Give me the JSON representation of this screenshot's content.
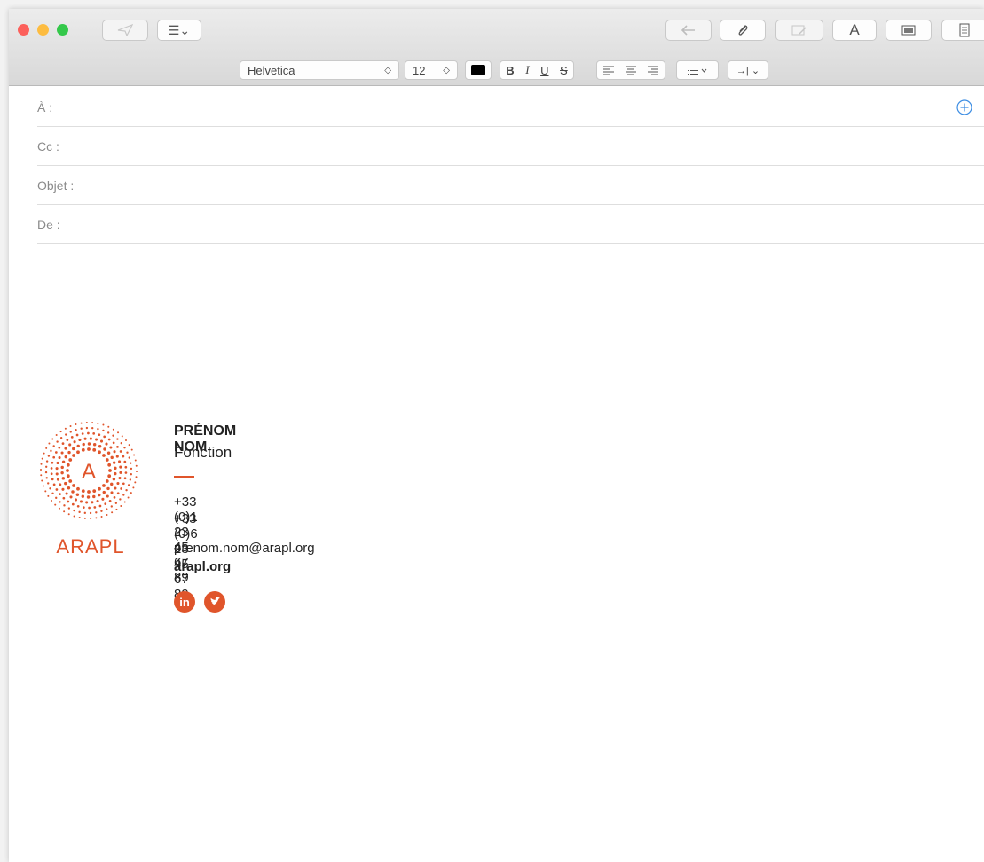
{
  "toolbar": {
    "list_button": "☰⌄",
    "format_font": "Helvetica",
    "format_size": "12",
    "bold": "B",
    "italic": "I",
    "underline": "U",
    "strike": "S",
    "indent": "→| ⌄",
    "text_button": "A"
  },
  "fields": {
    "to_label": "À :",
    "cc_label": "Cc :",
    "subject_label": "Objet :",
    "from_label": "De :"
  },
  "signature": {
    "brand": "ARAPL",
    "logo_letter": "A",
    "name": "PRÉNOM NOM",
    "role": "Fonction",
    "phone1": "+33 (0)1 23 45 67 89",
    "phone2": "+33 (0)6 23 45 67 89",
    "email": "prenom.nom@arapl.org",
    "website": "arapl.org",
    "linkedin": "in"
  },
  "colors": {
    "brand": "#e0552b",
    "link_blue": "#3c8de3"
  }
}
